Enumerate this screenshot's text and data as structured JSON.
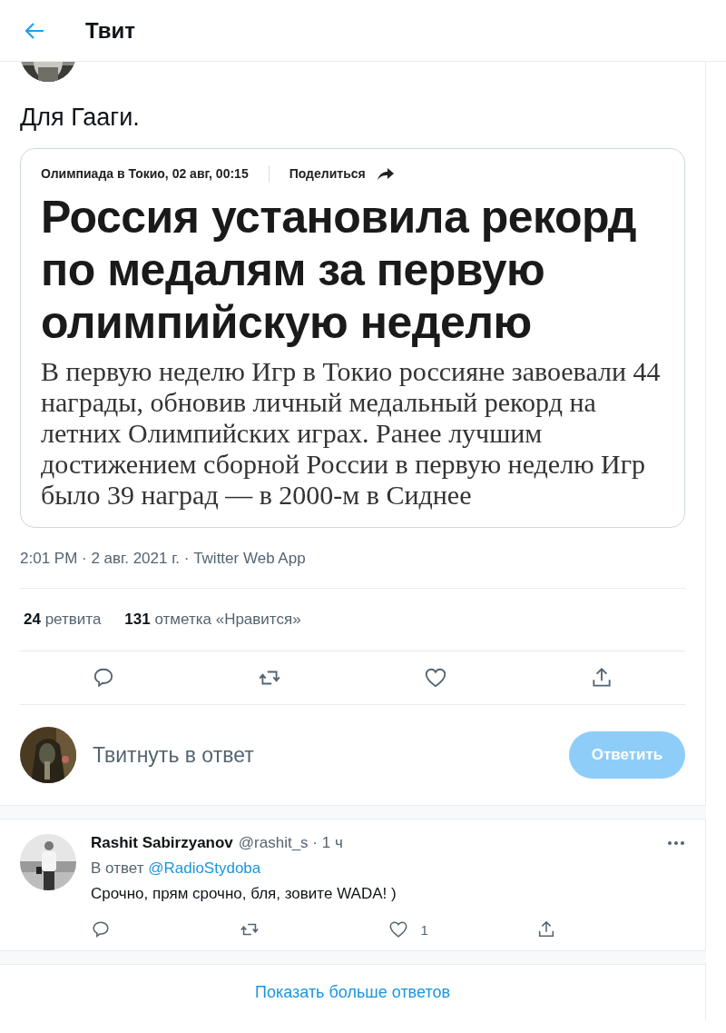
{
  "header": {
    "title": "Твит"
  },
  "tweet": {
    "text": "Для Гааги.",
    "card": {
      "meta": "Олимпиада в Токио, 02 авг, 00:15",
      "share": "Поделиться",
      "headline": "Россия установила рекорд по медалям за первую олимпийскую неделю",
      "body": "В первую неделю Игр в Токио россияне завоевали 44 награды, обновив личный медальный рекорд на летних Олимпийских играх. Ранее лучшим достижением сборной России в первую неделю Игр было 39 наград — в 2000-м в Сиднее"
    },
    "timestamp": "2:01 PM · 2 авг. 2021 г. · Twitter Web App",
    "stats": [
      {
        "count": "24",
        "label": "ретвита"
      },
      {
        "count": "131",
        "label": "отметка «Нравится»"
      }
    ],
    "actions": [
      {
        "kind": "reply"
      },
      {
        "kind": "retweet"
      },
      {
        "kind": "like"
      },
      {
        "kind": "share"
      }
    ]
  },
  "composer": {
    "placeholder": "Твитнуть в ответ",
    "button": {
      "label": "Ответить",
      "disabled": true
    }
  },
  "replies": [
    {
      "name": "Rashit Sabirzyanov",
      "handle_time": "@rashit_s · 1 ч",
      "reply_to_label": "В ответ",
      "reply_to": "@RadioStydoba",
      "text": "Срочно, прям срочно, бля, зовите WADA! )",
      "actions": [
        {
          "kind": "reply"
        },
        {
          "kind": "retweet"
        },
        {
          "kind": "like",
          "count": "1"
        },
        {
          "kind": "share"
        }
      ]
    }
  ],
  "show_more": "Показать больше ответов"
}
